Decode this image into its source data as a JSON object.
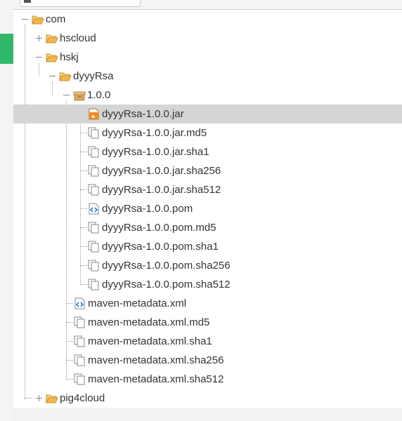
{
  "colors": {
    "accent": "#2fb86a",
    "selected_row": "#d5d5d5",
    "folder": "#f2b84b",
    "jar_badge": "#f08a24",
    "xml_badge": "#2a7fd4"
  },
  "tree": {
    "nodes": [
      {
        "label": "com",
        "icon": "folder-open-icon",
        "toggle": "collapse"
      },
      {
        "label": "hscloud",
        "icon": "folder-open-icon",
        "toggle": "expand"
      },
      {
        "label": "hskj",
        "icon": "folder-open-icon",
        "toggle": "collapse"
      },
      {
        "label": "dyyyRsa",
        "icon": "folder-open-icon",
        "toggle": "collapse"
      },
      {
        "label": "1.0.0",
        "icon": "version-package-icon",
        "toggle": "collapse"
      },
      {
        "label": "dyyyRsa-1.0.0.jar",
        "icon": "jar-file-icon",
        "selected": true
      },
      {
        "label": "dyyyRsa-1.0.0.jar.md5",
        "icon": "generic-file-icon"
      },
      {
        "label": "dyyyRsa-1.0.0.jar.sha1",
        "icon": "generic-file-icon"
      },
      {
        "label": "dyyyRsa-1.0.0.jar.sha256",
        "icon": "generic-file-icon"
      },
      {
        "label": "dyyyRsa-1.0.0.jar.sha512",
        "icon": "generic-file-icon"
      },
      {
        "label": "dyyyRsa-1.0.0.pom",
        "icon": "xml-file-icon"
      },
      {
        "label": "dyyyRsa-1.0.0.pom.md5",
        "icon": "generic-file-icon"
      },
      {
        "label": "dyyyRsa-1.0.0.pom.sha1",
        "icon": "generic-file-icon"
      },
      {
        "label": "dyyyRsa-1.0.0.pom.sha256",
        "icon": "generic-file-icon"
      },
      {
        "label": "dyyyRsa-1.0.0.pom.sha512",
        "icon": "generic-file-icon"
      },
      {
        "label": "maven-metadata.xml",
        "icon": "xml-file-icon"
      },
      {
        "label": "maven-metadata.xml.md5",
        "icon": "generic-file-icon"
      },
      {
        "label": "maven-metadata.xml.sha1",
        "icon": "generic-file-icon"
      },
      {
        "label": "maven-metadata.xml.sha256",
        "icon": "generic-file-icon"
      },
      {
        "label": "maven-metadata.xml.sha512",
        "icon": "generic-file-icon"
      },
      {
        "label": "pig4cloud",
        "icon": "folder-open-icon",
        "toggle": "expand"
      }
    ]
  }
}
